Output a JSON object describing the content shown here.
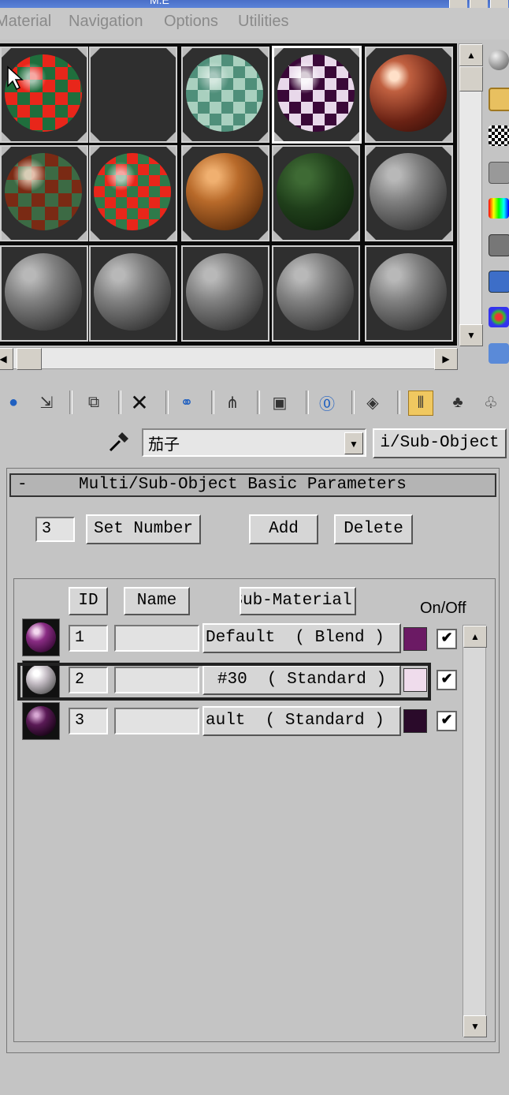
{
  "window": {
    "title": "M.E"
  },
  "menu": [
    "Material",
    "Navigation",
    "Options",
    "Utilities"
  ],
  "colors": {
    "purple_dark": "#6b1a64",
    "lavender": "#efdcec",
    "deep_purple": "#2a0a2a"
  },
  "sample_slots": [
    {
      "icon": "red-green-checker-sphere-icon"
    },
    {
      "icon": "empty-slot-icon"
    },
    {
      "icon": "teal-checker-sphere-icon"
    },
    {
      "icon": "purple-checker-sphere-icon"
    },
    {
      "icon": "copper-sphere-icon"
    },
    {
      "icon": "brown-checker-sphere-icon"
    },
    {
      "icon": "red-green-checker-sphere-icon"
    },
    {
      "icon": "wood-sphere-icon"
    },
    {
      "icon": "dark-green-sphere-icon"
    },
    {
      "icon": "gray-sphere-icon"
    },
    {
      "icon": "gray-sphere-icon"
    },
    {
      "icon": "gray-sphere-icon"
    },
    {
      "icon": "gray-sphere-icon"
    },
    {
      "icon": "gray-sphere-icon"
    },
    {
      "icon": "gray-sphere-icon"
    }
  ],
  "material": {
    "name": "茄子",
    "type_button": "i/Sub-Object"
  },
  "rollout": {
    "collapse": "-",
    "title": "Multi/Sub-Object Basic Parameters",
    "number_value": "3",
    "set_number": "Set Number",
    "add": "Add",
    "delete": "Delete"
  },
  "list": {
    "headers": {
      "id": "ID",
      "name": "Name",
      "sub_material": "Sub-Material",
      "on_off": "On/Off"
    },
    "rows": [
      {
        "id": "1",
        "name": "",
        "sub_material": "Default  ( Blend )",
        "color": "#6b1a64",
        "on": "✔"
      },
      {
        "id": "2",
        "name": "",
        "sub_material": "#30  ( Standard )",
        "color": "#efdcec",
        "on": "✔"
      },
      {
        "id": "3",
        "name": "",
        "sub_material": "ault  ( Standard )",
        "color": "#2a0a2a",
        "on": "✔"
      }
    ]
  }
}
